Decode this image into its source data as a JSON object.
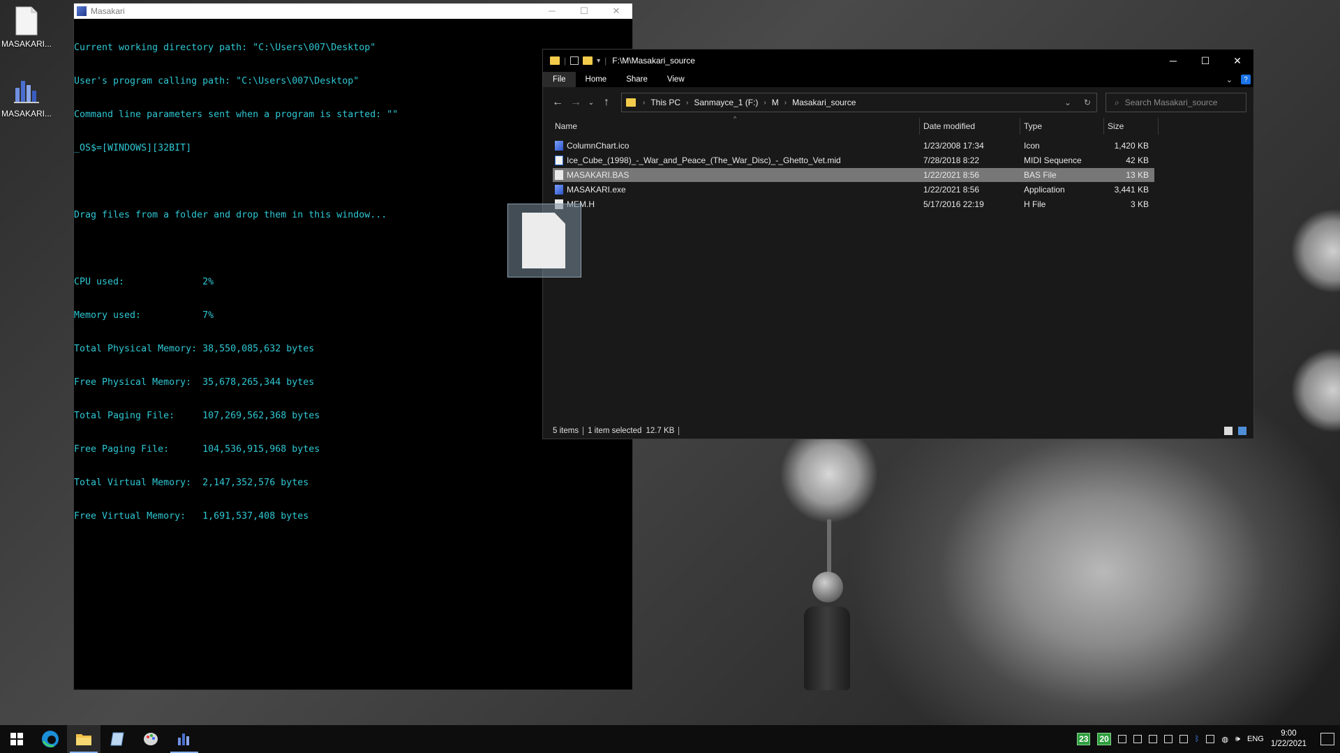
{
  "desktop": {
    "icons": [
      {
        "label": "MASAKARI...",
        "icon": "document-icon"
      },
      {
        "label": "MASAKARI...",
        "icon": "app-chart-icon"
      }
    ]
  },
  "console": {
    "title": "Masakari",
    "lines": [
      "Current working directory path: \"C:\\Users\\007\\Desktop\"",
      "User's program calling path: \"C:\\Users\\007\\Desktop\"",
      "Command line parameters sent when a program is started: \"\"",
      "_OS$=[WINDOWS][32BIT]",
      "",
      "Drag files from a folder and drop them in this window...",
      "",
      "CPU used:              2%",
      "Memory used:           7%",
      "Total Physical Memory: 38,550,085,632 bytes",
      "Free Physical Memory:  35,678,265,344 bytes",
      "Total Paging File:     107,269,562,368 bytes",
      "Free Paging File:      104,536,915,968 bytes",
      "Total Virtual Memory:  2,147,352,576 bytes",
      "Free Virtual Memory:   1,691,537,408 bytes"
    ],
    "text_color": "#2fc7d3"
  },
  "explorer": {
    "title": "F:\\M\\Masakari_source",
    "ribbon_tabs": [
      "File",
      "Home",
      "Share",
      "View"
    ],
    "breadcrumb": [
      "This PC",
      "Sanmayce_1 (F:)",
      "M",
      "Masakari_source"
    ],
    "search_placeholder": "Search Masakari_source",
    "columns": {
      "name": "Name",
      "date": "Date modified",
      "type": "Type",
      "size": "Size"
    },
    "files": [
      {
        "name": "ColumnChart.ico",
        "date": "1/23/2008 17:34",
        "type": "Icon",
        "size": "1,420 KB",
        "icon": "ico"
      },
      {
        "name": "Ice_Cube_(1998)_-_War_and_Peace_(The_War_Disc)_-_Ghetto_Vet.mid",
        "date": "7/28/2018 8:22",
        "type": "MIDI Sequence",
        "size": "42 KB",
        "icon": "mid"
      },
      {
        "name": "MASAKARI.BAS",
        "date": "1/22/2021 8:56",
        "type": "BAS File",
        "size": "13 KB",
        "icon": "doc",
        "selected": true
      },
      {
        "name": "MASAKARI.exe",
        "date": "1/22/2021 8:56",
        "type": "Application",
        "size": "3,441 KB",
        "icon": "ico"
      },
      {
        "name": "MEM.H",
        "date": "5/17/2016 22:19",
        "type": "H File",
        "size": "3 KB",
        "icon": "doc"
      }
    ],
    "status": {
      "count": "5 items",
      "selected": "1 item selected",
      "selected_size": "12.7 KB"
    }
  },
  "taskbar": {
    "badges": [
      "23",
      "20"
    ],
    "language": "ENG",
    "time": "9:00",
    "date": "1/22/2021"
  }
}
